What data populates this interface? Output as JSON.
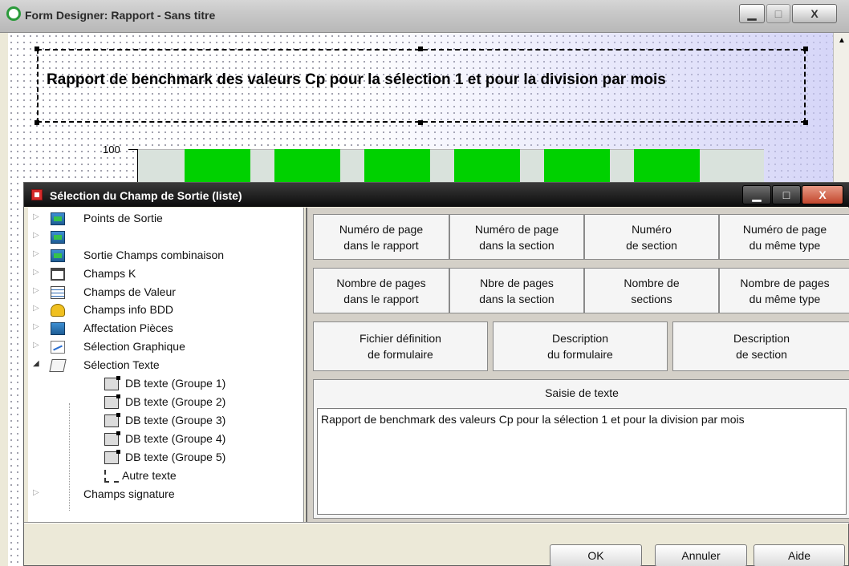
{
  "outer_window": {
    "title": "Form Designer: Rapport - Sans titre",
    "controls": {
      "minimize": "▁",
      "maximize": "□",
      "close": "X"
    }
  },
  "canvas": {
    "report_title": "Rapport de benchmark des valeurs Cp pour la sélection 1 et pour la division par mois",
    "chart": {
      "tick_label": "100"
    }
  },
  "chart_data": {
    "type": "bar",
    "categories": [
      "",
      "",
      "",
      "",
      "",
      ""
    ],
    "values": [
      100,
      100,
      100,
      100,
      100,
      100
    ],
    "title": "",
    "xlabel": "",
    "ylabel": "",
    "yticks": [
      "100"
    ],
    "colors": {
      "bar": "#00d100",
      "plot_bg": "#d9e2dc"
    }
  },
  "dialog": {
    "title": "Sélection du Champ de Sortie (liste)",
    "controls": {
      "minimize": "▁",
      "maximize": "□",
      "close": "X"
    },
    "tree": [
      {
        "label": "Points de Sortie",
        "icon": "monitor-icon"
      },
      {
        "label": "",
        "icon": "monitor-icon"
      },
      {
        "label": "Sortie Champs combinaison",
        "icon": "monitor-icon"
      },
      {
        "label": "Champs K",
        "icon": "k-field-icon"
      },
      {
        "label": "Champs de Valeur",
        "icon": "value-field-icon"
      },
      {
        "label": "Champs info BDD",
        "icon": "database-icon"
      },
      {
        "label": "Affectation Pièces",
        "icon": "monitor-icon"
      },
      {
        "label": "Sélection Graphique",
        "icon": "graph-icon"
      },
      {
        "label": "Sélection Texte",
        "icon": "text-icon"
      },
      {
        "label": "DB texte (Groupe 1)",
        "icon": "db-text-icon"
      },
      {
        "label": "DB texte (Groupe 2)",
        "icon": "db-text-icon"
      },
      {
        "label": "DB texte (Groupe 3)",
        "icon": "db-text-icon"
      },
      {
        "label": "DB texte (Groupe 4)",
        "icon": "db-text-icon"
      },
      {
        "label": "DB texte (Groupe 5)",
        "icon": "db-text-icon"
      },
      {
        "label": "Autre texte",
        "icon": "other-text-icon"
      },
      {
        "label": "Champs signature",
        "icon": ""
      }
    ],
    "buttons_row1": [
      "Numéro de page\ndans le rapport",
      "Numéro de page\ndans la section",
      "Numéro\nde section",
      "Numéro de page\ndu même type"
    ],
    "buttons_row2": [
      "Nombre de pages\ndans le rapport",
      "Nbre de pages\ndans la section",
      "Nombre de\nsections",
      "Nombre de pages\ndu même type"
    ],
    "buttons_row3": [
      "Fichier définition\nde formulaire",
      "Description\ndu formulaire",
      "Description\nde section"
    ],
    "text_entry": {
      "label": "Saisie de texte",
      "value": "Rapport de benchmark des valeurs Cp pour la sélection 1 et pour la division par mois"
    },
    "footer": {
      "ok": "OK",
      "cancel": "Annuler",
      "help": "Aide"
    }
  }
}
